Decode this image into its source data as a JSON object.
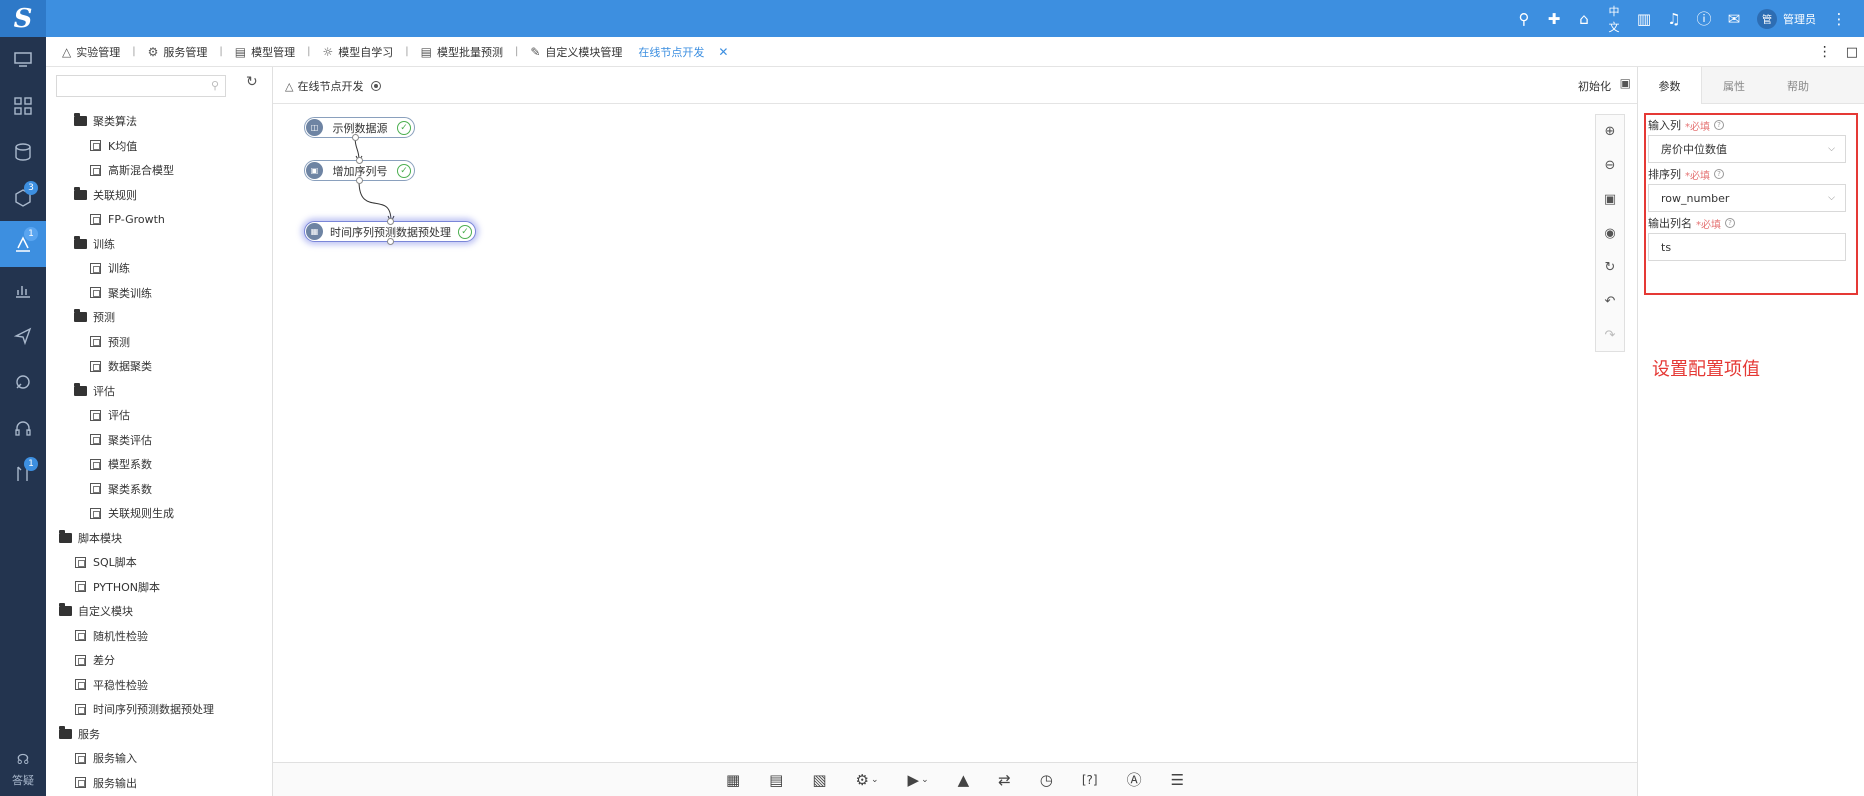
{
  "topbar": {
    "logo": "S",
    "language": "中文",
    "avatar_text": "管",
    "username": "管理员"
  },
  "leftnav": {
    "badges": {
      "models": "3",
      "modeling": "1",
      "tools": "1"
    },
    "help_label": "答疑"
  },
  "tabs": [
    {
      "icon": "flask-icon",
      "label": "实验管理"
    },
    {
      "icon": "service-icon",
      "label": "服务管理"
    },
    {
      "icon": "chart-icon",
      "label": "模型管理"
    },
    {
      "icon": "bulb-icon",
      "label": "模型自学习"
    },
    {
      "icon": "chart-icon",
      "label": "模型批量预测"
    },
    {
      "icon": "edit-icon",
      "label": "自定义模块管理"
    },
    {
      "icon": "",
      "label": "在线节点开发",
      "current": true
    }
  ],
  "tree": {
    "search_placeholder": "",
    "items": [
      {
        "label": "聚类算法",
        "type": "folder",
        "level": 2
      },
      {
        "label": "K均值",
        "type": "leaf",
        "level": 3
      },
      {
        "label": "高斯混合模型",
        "type": "leaf",
        "level": 3
      },
      {
        "label": "关联规则",
        "type": "folder",
        "level": 2
      },
      {
        "label": "FP-Growth",
        "type": "leaf",
        "level": 3
      },
      {
        "label": "训练",
        "type": "folder",
        "level": 2
      },
      {
        "label": "训练",
        "type": "leaf",
        "level": 3
      },
      {
        "label": "聚类训练",
        "type": "leaf",
        "level": 3
      },
      {
        "label": "预测",
        "type": "folder",
        "level": 2
      },
      {
        "label": "预测",
        "type": "leaf",
        "level": 3
      },
      {
        "label": "数据聚类",
        "type": "leaf",
        "level": 3
      },
      {
        "label": "评估",
        "type": "folder",
        "level": 2
      },
      {
        "label": "评估",
        "type": "leaf",
        "level": 3
      },
      {
        "label": "聚类评估",
        "type": "leaf",
        "level": 3
      },
      {
        "label": "模型系数",
        "type": "leaf",
        "level": 3
      },
      {
        "label": "聚类系数",
        "type": "leaf",
        "level": 3
      },
      {
        "label": "关联规则生成",
        "type": "leaf",
        "level": 3
      },
      {
        "label": "脚本模块",
        "type": "folder",
        "level": 1
      },
      {
        "label": "SQL脚本",
        "type": "leaf",
        "level": 2
      },
      {
        "label": "PYTHON脚本",
        "type": "leaf",
        "level": 2
      },
      {
        "label": "自定义模块",
        "type": "folder",
        "level": 1
      },
      {
        "label": "随机性检验",
        "type": "leaf",
        "level": 2
      },
      {
        "label": "差分",
        "type": "leaf",
        "level": 2
      },
      {
        "label": "平稳性检验",
        "type": "leaf",
        "level": 2
      },
      {
        "label": "时间序列预测数据预处理",
        "type": "leaf",
        "level": 2
      },
      {
        "label": "服务",
        "type": "folder",
        "level": 1
      },
      {
        "label": "服务输入",
        "type": "leaf",
        "level": 2
      },
      {
        "label": "服务输出",
        "type": "leaf",
        "level": 2
      }
    ]
  },
  "canvas_head": {
    "title": "在线节点开发",
    "init_label": "初始化"
  },
  "nodes": [
    {
      "label": "示例数据源"
    },
    {
      "label": "增加序列号"
    },
    {
      "label": "时间序列预测数据预处理"
    }
  ],
  "panel": {
    "tabs": [
      "参数",
      "属性",
      "帮助"
    ],
    "fields": [
      {
        "label": "输入列",
        "required": "*必填",
        "value": "房价中位数值",
        "type": "select"
      },
      {
        "label": "排序列",
        "required": "*必填",
        "value": "row_number",
        "type": "select"
      },
      {
        "label": "输出列名",
        "required": "*必填",
        "value": "ts",
        "type": "input"
      }
    ],
    "annotation": "设置配置项值"
  },
  "colors": {
    "topbar": "#3d8fe0",
    "leftnav": "#23344f",
    "annotation": "#e53935"
  }
}
